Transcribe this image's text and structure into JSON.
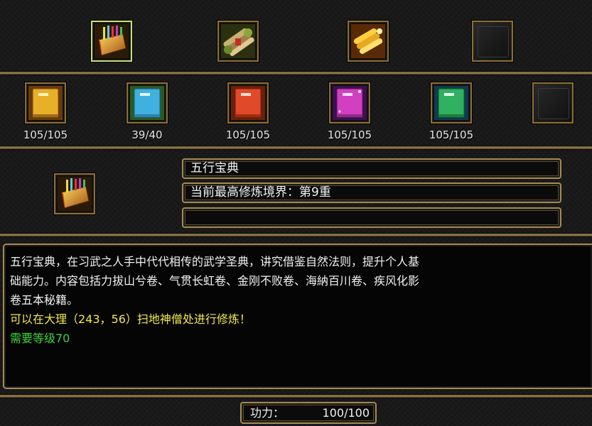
{
  "top_row": {
    "slots": [
      {
        "icon": "golden-tome-icon",
        "selected": true
      },
      {
        "icon": "scroll-bundle-icon"
      },
      {
        "icon": "gold-scrolls-icon"
      },
      {
        "icon": "empty-slot-icon",
        "empty": true
      }
    ]
  },
  "book_row": {
    "slots": [
      {
        "icon": "yellow-book-icon",
        "count": "105/105",
        "color": "#d9a020"
      },
      {
        "icon": "blue-book-icon",
        "count": "39/40",
        "color": "#38a8d8"
      },
      {
        "icon": "red-book-icon",
        "count": "105/105",
        "color": "#d83a28"
      },
      {
        "icon": "purple-book-icon",
        "count": "105/105",
        "color": "#c02ab0"
      },
      {
        "icon": "green-book-icon",
        "count": "105/105",
        "color": "#28b05a"
      },
      {
        "icon": "empty-slot-icon",
        "count": "",
        "empty": true
      }
    ]
  },
  "detail": {
    "icon": "golden-tome-icon",
    "name": "五行宝典",
    "realm": "当前最高修炼境界：第9重",
    "extra": ""
  },
  "description": {
    "line1": "五行宝典，在习武之人手中代代相传的武学圣典，讲究借鉴自然法则，提升个人基",
    "line2": "础能力。内容包括力拔山兮卷、气贯长虹卷、金刚不败卷、海納百川卷、疾风化影",
    "line3": "卷五本秘籍。",
    "line4": "可以在大理（243，56）扫地神僧处进行修炼！",
    "line5": "需要等级70"
  },
  "power": {
    "label": "功力：",
    "value": "100/100"
  },
  "colors": {
    "frame_gold": "#a58a52",
    "text_yellow": "#f2e84a",
    "text_green": "#3ed43e"
  }
}
